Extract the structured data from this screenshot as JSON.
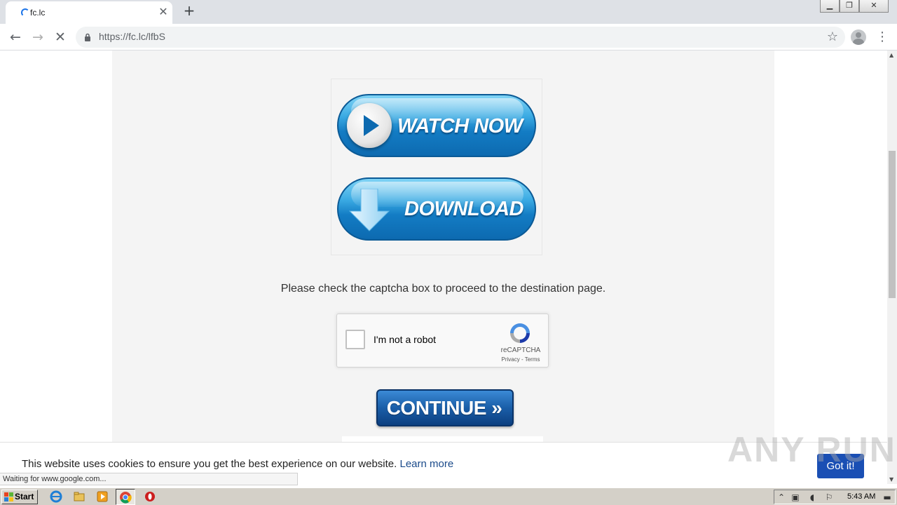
{
  "browser": {
    "tab_title": "fc.lc",
    "url": "https://fc.lc/lfbS",
    "status_text": "Waiting for www.google.com..."
  },
  "page": {
    "watch_now_label": "WATCH NOW",
    "download_label": "DOWNLOAD",
    "captcha_instruction": "Please check the captcha box to proceed to the destination page.",
    "recaptcha": {
      "label": "I'm not a robot",
      "brand": "reCAPTCHA",
      "links": "Privacy - Terms"
    },
    "continue_label": "CONTINUE »"
  },
  "cookie_bar": {
    "text": "This website uses cookies to ensure you get the best experience on our website.",
    "link": "Learn more",
    "button": "Got it!"
  },
  "watermark": "ANY RUN",
  "taskbar": {
    "start_label": "Start",
    "clock": "5:43 AM"
  },
  "colors": {
    "button_blue": "#137cc4",
    "cookie_button": "#1a4fb4",
    "link": "#1a4a8a"
  }
}
